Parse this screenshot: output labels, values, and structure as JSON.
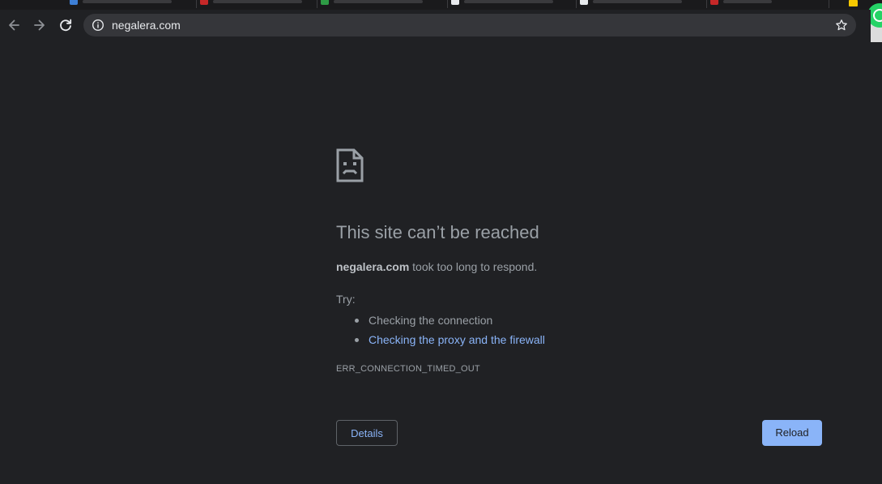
{
  "browser": {
    "url": "negalera.com"
  },
  "error_page": {
    "headline": "This site can’t be reached",
    "host": "negalera.com",
    "message": " took too long to respond.",
    "try_label": "Try:",
    "suggestions": [
      {
        "text": "Checking the connection"
      },
      {
        "text": "Checking the proxy and the firewall"
      }
    ],
    "error_code": "ERR_CONNECTION_TIMED_OUT",
    "details_button": "Details",
    "reload_button": "Reload"
  },
  "icons": {
    "back": "arrow-left-icon",
    "forward": "arrow-right-icon",
    "reload": "reload-icon",
    "site_info": "info-icon",
    "bookmark": "star-icon",
    "error": "sad-page-icon"
  },
  "colors": {
    "background": "#202124",
    "omnibox": "#35363a",
    "link": "#8ab4f8",
    "text": "#9aa0a6",
    "primary_button": "#8ab4f8"
  }
}
